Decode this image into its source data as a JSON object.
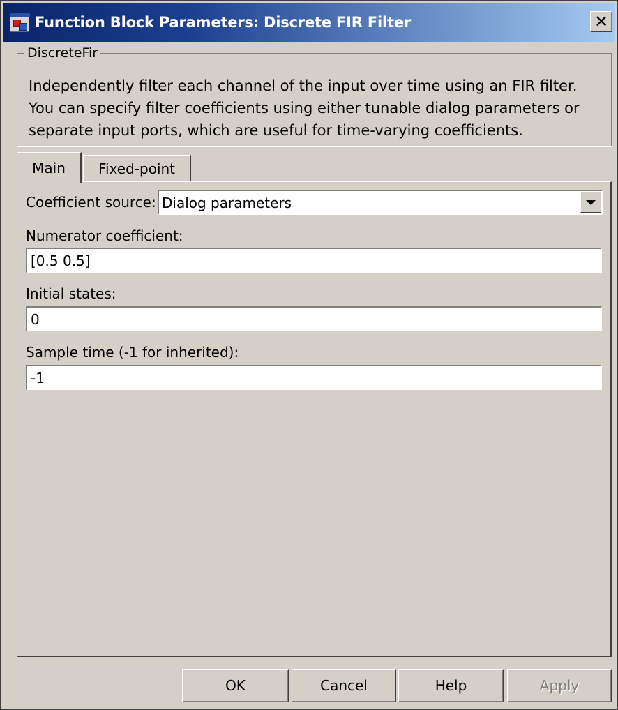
{
  "window": {
    "title": "Function Block Parameters: Discrete FIR Filter",
    "close_label": "✕"
  },
  "group": {
    "legend": "DiscreteFir",
    "description": "Independently filter each channel of the input over time using an FIR filter. You can specify filter coefficients using either tunable dialog parameters or separate input ports, which are useful for time-varying coefficients."
  },
  "tabs": [
    {
      "label": "Main",
      "active": true
    },
    {
      "label": "Fixed-point",
      "active": false
    }
  ],
  "main": {
    "coefficient_source_label": "Coefficient source:",
    "coefficient_source_value": "Dialog parameters",
    "numerator_label": "Numerator coefficient:",
    "numerator_value": "[0.5 0.5]",
    "initial_states_label": "Initial states:",
    "initial_states_value": "0",
    "sample_time_label": "Sample time (-1 for inherited):",
    "sample_time_value": "-1"
  },
  "buttons": {
    "ok": "OK",
    "cancel": "Cancel",
    "help": "Help",
    "apply": "Apply"
  },
  "colors": {
    "titlebar_start": "#0a246a",
    "titlebar_end": "#a6caf0",
    "face": "#d4d0c8"
  }
}
